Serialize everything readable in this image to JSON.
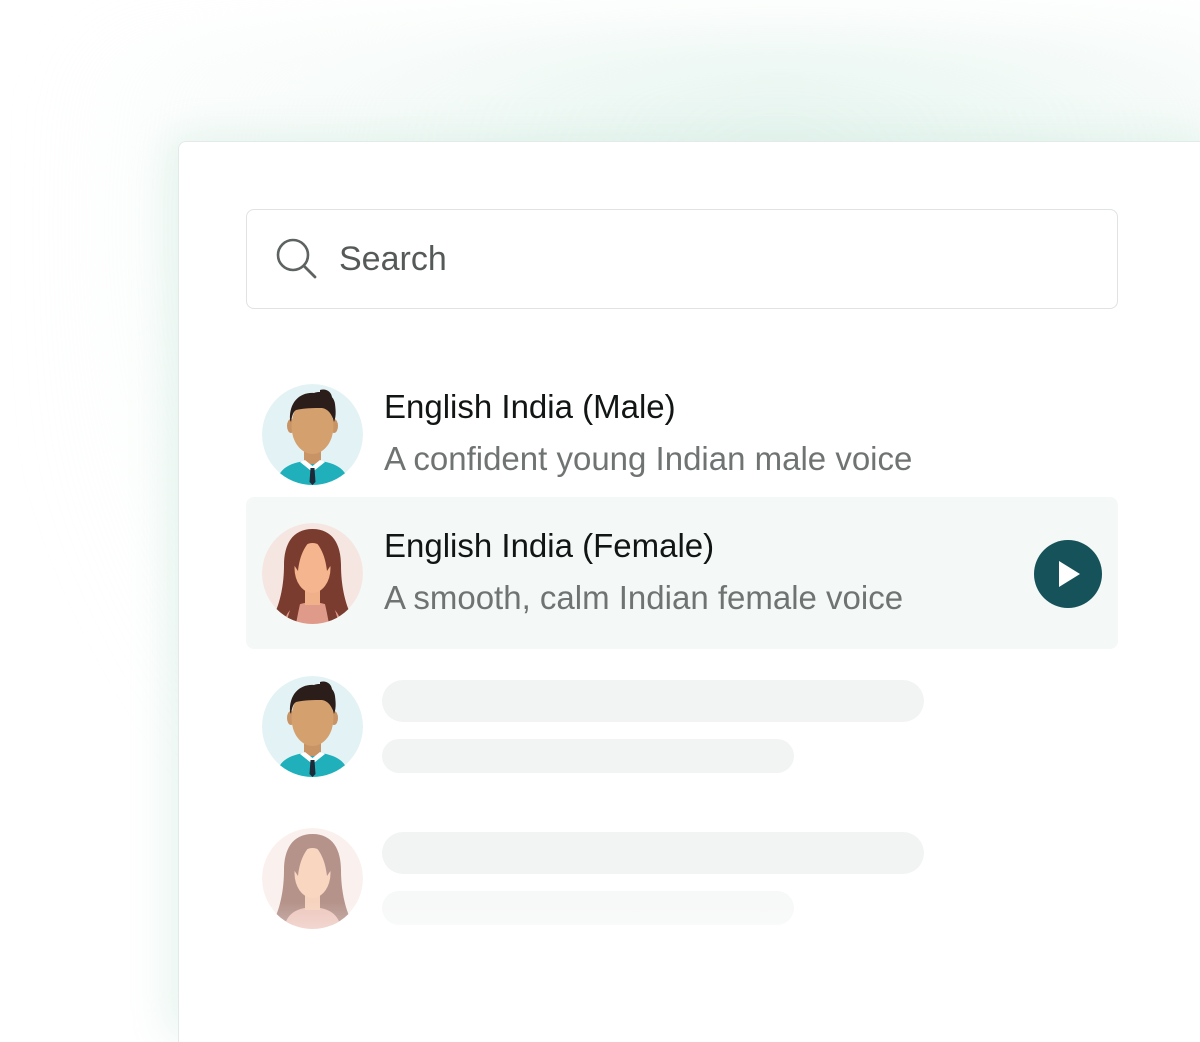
{
  "search": {
    "placeholder": "Search",
    "icon": "search-icon"
  },
  "voices": [
    {
      "name": "English India (Male)",
      "description": "A confident young Indian male voice",
      "avatar": "male-avatar-icon",
      "selected": false
    },
    {
      "name": "English India (Female)",
      "description": "A smooth, calm Indian female voice",
      "avatar": "female-avatar-icon",
      "selected": true,
      "play_icon": "play-icon"
    }
  ],
  "placeholder_rows": [
    {
      "avatar": "male-avatar-icon",
      "state": "loading"
    },
    {
      "avatar": "female-avatar-icon",
      "state": "loading"
    }
  ],
  "colors": {
    "accent": "#16525a",
    "highlight_row": "#f4f8f7",
    "skeleton": "#f2f4f3",
    "name_text": "#111513",
    "description_text": "#6f7472"
  }
}
